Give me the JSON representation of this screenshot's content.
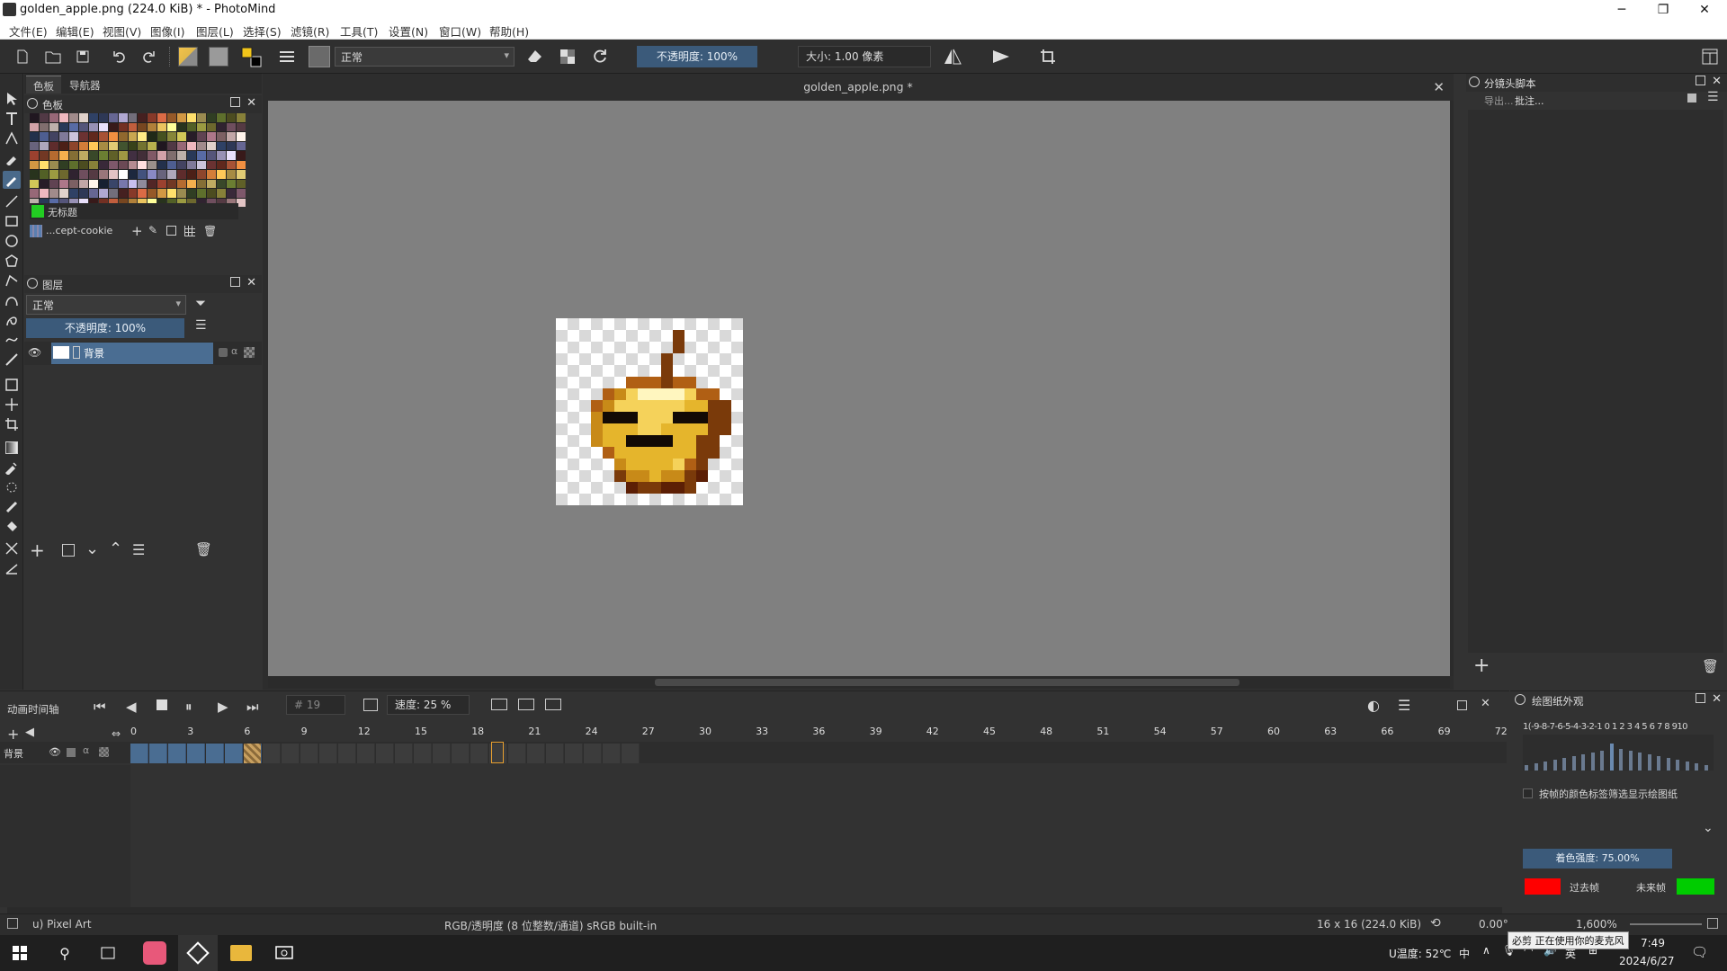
{
  "window": {
    "title": "golden_apple.png (224.0 KiB)  * - PhotoMind",
    "minimize": "─",
    "maximize": "❐",
    "close": "✕"
  },
  "menu": [
    "文件(E)",
    "编辑(E)",
    "视图(V)",
    "图像(I)",
    "图层(L)",
    "选择(S)",
    "滤镜(R)",
    "工具(T)",
    "设置(N)",
    "窗口(W)",
    "帮助(H)"
  ],
  "toolbar": {
    "blend_mode": "正常",
    "opacity": "不透明度:  100%",
    "size": "大小:  1.00 像素"
  },
  "left_dock": {
    "tabs": [
      "色板",
      "导航器"
    ],
    "palette_title": "色板",
    "color_name": "无标题",
    "palette_name": "...cept-cookie",
    "layers_title": "图层",
    "layer_blend": "正常",
    "layer_opacity": "不透明度:  100%",
    "layer_name": "背景"
  },
  "canvas": {
    "tab_title": "golden_apple.png *",
    "image": {
      "width": 16,
      "height": 16,
      "palette": {
        "o": "#5c1f05",
        "r": "#7a3a0a",
        "b": "#b05f14",
        "d": "#c88a18",
        "y": "#e5b52c",
        "l": "#f5d25a",
        "w": "#fff6bf",
        "k": "#120a05"
      },
      "rows": [
        "................",
        "..........r.....",
        "..........r.....",
        ".........r......",
        ".........r......",
        "......bbbrbb....",
        "....bdlwwwwlbb..",
        "...bdllllllyyrr.",
        "...dkkklllkkkrr.",
        "...dyyyllyyyyrr.",
        "...dyykkkkyyrr..",
        "....byyyyyyyrr..",
        ".....dyyyylbr...",
        ".....rddyddro...",
        "......orroor....",
        "................"
      ]
    }
  },
  "right_dock": {
    "title": "分镜头脚本",
    "export": "导出...",
    "comment": "批注..."
  },
  "timeline": {
    "title": "动画时间轴",
    "frame": "# 19",
    "speed": "速度:  25 %",
    "layer": "背景",
    "ruler": [
      "0",
      "3",
      "6",
      "9",
      "12",
      "15",
      "18",
      "21",
      "24",
      "27",
      "30",
      "33",
      "36",
      "39",
      "42",
      "45",
      "48",
      "51",
      "54",
      "57",
      "60",
      "63",
      "66",
      "69",
      "72"
    ]
  },
  "onion": {
    "title": "绘图纸外观",
    "numbers": "1(-9-8-7-6-5-4-3-2-1 0 1 2 3 4 5 6 7 8 910",
    "checkbox_label": "按帧的颜色标签筛选显示绘图纸",
    "tint": "着色强度:  75.00%",
    "prev": "过去帧",
    "next": "未来帧",
    "prev_color": "#ff0000",
    "next_color": "#00cc00"
  },
  "status": {
    "brush": "u) Pixel Art",
    "color_space": "RGB/透明度 (8 位整数/通道)  sRGB built-in",
    "size": "16 x 16 (224.0 KiB)",
    "rotation": "0.00°",
    "zoom": "1,600%"
  },
  "taskbar": {
    "temp": "U温度: 52℃",
    "ime1": "中",
    "ime2": "英",
    "time": "7:49",
    "date": "2024/6/27",
    "tooltip": "必剪 正在使用你的麦克风"
  }
}
